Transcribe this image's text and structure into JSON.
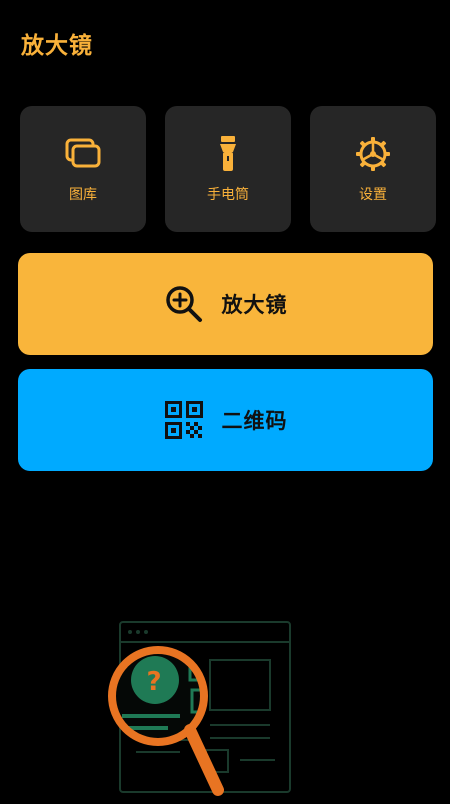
{
  "app": {
    "title": "放大镜"
  },
  "tiles": [
    {
      "label": "图库",
      "icon": "gallery-icon"
    },
    {
      "label": "手电筒",
      "icon": "flashlight-icon"
    },
    {
      "label": "设置",
      "icon": "gear-icon"
    }
  ],
  "buttons": {
    "magnifier": {
      "label": "放大镜",
      "icon": "zoom-in-icon",
      "color": "#f9b53b"
    },
    "qrcode": {
      "label": "二维码",
      "icon": "qr-code-icon",
      "color": "#00aaff"
    }
  },
  "colors": {
    "accent": "#f9b13a",
    "tile_bg": "#262626",
    "background": "#000000",
    "magnifier_ring": "#e87422",
    "illustration_green": "#1f7a55"
  }
}
